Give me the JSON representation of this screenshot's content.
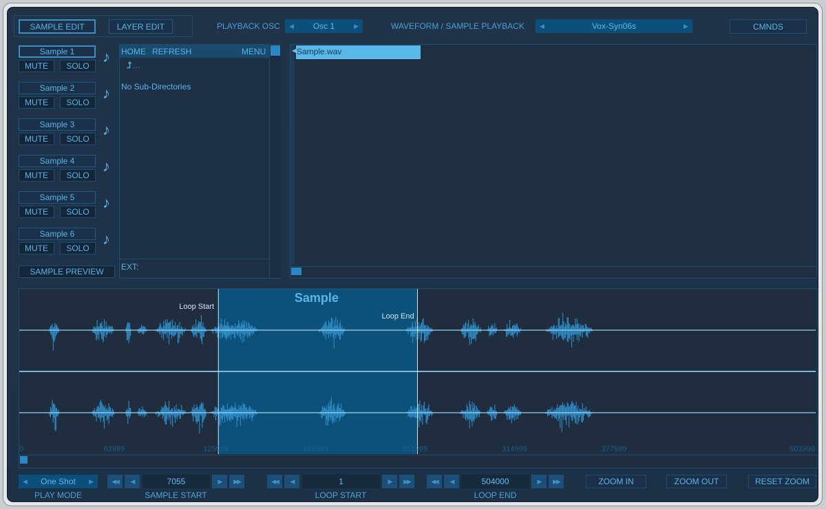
{
  "header": {
    "tabs": [
      {
        "label": "SAMPLE EDIT",
        "selected": true
      },
      {
        "label": "LAYER EDIT",
        "selected": false
      }
    ],
    "playback_osc_label": "PLAYBACK OSC",
    "playback_osc_value": "Osc 1",
    "waveform_label": "WAVEFORM / SAMPLE PLAYBACK",
    "waveform_value": "Vox-Syn06s",
    "cmnds_label": "CMNDS"
  },
  "samples": [
    {
      "label": "Sample 1",
      "selected": true,
      "mute": "MUTE",
      "solo": "SOLO"
    },
    {
      "label": "Sample 2",
      "selected": false,
      "mute": "MUTE",
      "solo": "SOLO"
    },
    {
      "label": "Sample 3",
      "selected": false,
      "mute": "MUTE",
      "solo": "SOLO"
    },
    {
      "label": "Sample 4",
      "selected": false,
      "mute": "MUTE",
      "solo": "SOLO"
    },
    {
      "label": "Sample 5",
      "selected": false,
      "mute": "MUTE",
      "solo": "SOLO"
    },
    {
      "label": "Sample 6",
      "selected": false,
      "mute": "MUTE",
      "solo": "SOLO"
    }
  ],
  "sample_preview_label": "SAMPLE PREVIEW",
  "browser": {
    "home": "HOME",
    "refresh": "REFRESH",
    "menu": "MENU",
    "up_dir": "…",
    "empty_message": "No Sub-Directories",
    "ext_label": "EXT:"
  },
  "file_list": {
    "files": [
      "Sample.wav"
    ],
    "selected": "Sample.wav"
  },
  "waveform": {
    "title": "Sample",
    "loop_start_label": "Loop Start",
    "loop_end_label": "Loop End",
    "total_samples": 504000,
    "loop_start_fraction": 0.25,
    "loop_end_fraction": 0.5,
    "ticks": [
      "0",
      "62999",
      "125999",
      "188999",
      "251999",
      "314999",
      "377999",
      "503999"
    ],
    "scroll_position": 0
  },
  "controls": {
    "play_mode": {
      "value": "One Shot",
      "label": "PLAY MODE"
    },
    "sample_start": {
      "value": "7055",
      "label": "SAMPLE START"
    },
    "loop_start": {
      "value": "1",
      "label": "LOOP START"
    },
    "loop_end": {
      "value": "504000",
      "label": "LOOP END"
    },
    "zoom_in": "ZOOM IN",
    "zoom_out": "ZOOM OUT",
    "reset_zoom": "RESET ZOOM"
  },
  "icons": {
    "note": "♪",
    "left": "◀",
    "right": "▶",
    "fast_left": "◀◀",
    "fast_right": "▶▶",
    "up": "⮥",
    "speaker": "◀"
  },
  "colors": {
    "accent": "#58b4ea",
    "panel_bg": "#1f3349",
    "loop_region": "#0b5179",
    "waveform": "#2f8dc8",
    "selected_file": "#5ab7ea"
  }
}
